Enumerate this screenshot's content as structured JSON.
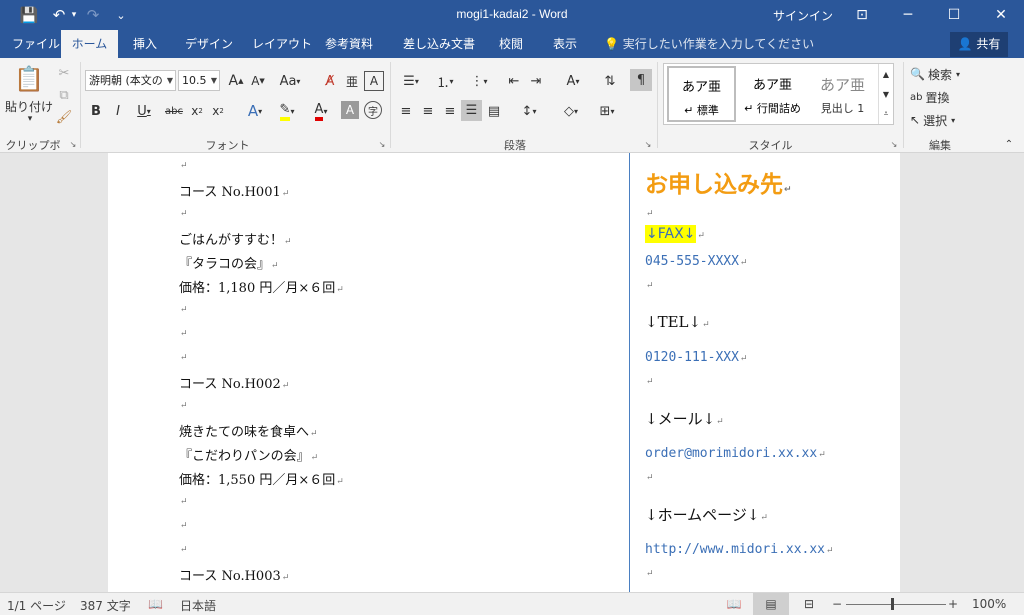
{
  "window": {
    "title": "mogi1-kadai2  -  Word",
    "signin": "サインイン",
    "buttons": {
      "ribbon_display": "⊡",
      "minimize": "─",
      "maximize": "☐",
      "close": "✕"
    }
  },
  "quick_access": {
    "save": "💾",
    "undo": "↶",
    "undo_arrow": "▾",
    "redo": "↷",
    "customize": "⌄"
  },
  "tabs": [
    "ファイル",
    "ホーム",
    "挿入",
    "デザイン",
    "レイアウト",
    "参考資料",
    "差し込み文書",
    "校閲",
    "表示"
  ],
  "tell_me": "実行したい作業を入力してください",
  "share": "共有",
  "ribbon": {
    "clipboard": {
      "paste": "貼り付け",
      "label": "クリップボード"
    },
    "font": {
      "name": "游明朝 (本文の",
      "size": "10.5",
      "label": "フォント",
      "aa": "Aa"
    },
    "paragraph": {
      "label": "段落"
    },
    "styles": {
      "label": "スタイル",
      "items": [
        {
          "preview": "あア亜",
          "name": "↵ 標準"
        },
        {
          "preview": "あア亜",
          "name": "↵ 行間詰め"
        },
        {
          "preview": "あア亜",
          "name": "見出し 1"
        }
      ]
    },
    "editing": {
      "label": "編集",
      "find": "検索",
      "replace": "置換",
      "select": "選択"
    }
  },
  "document": {
    "left_lines": [
      "",
      "コース No.H001",
      "",
      "ごはんがすすむ！",
      "『タラコの会』",
      "価格：1,180 円／月×６回",
      "",
      "",
      "",
      "コース No.H002",
      "",
      "焼きたての味を食卓へ",
      "『こだわりパンの会』",
      "価格：1,550 円／月×６回",
      "",
      "",
      "",
      "コース No.H003"
    ],
    "right": {
      "heading": "お申し込み先",
      "fax_label": "↓FAX↓",
      "fax": "045-555-XXXX",
      "tel_label": "↓TEL↓",
      "tel": "0120-111-XXX",
      "mail_label": "↓メール↓",
      "mail": "order@morimidori.xx.xx",
      "hp_label": "↓ホームページ↓",
      "hp": "http://www.midori.xx.xx"
    },
    "para_mark": "↵"
  },
  "status": {
    "page": "1/1 ページ",
    "words": "387 文字",
    "language": "日本語",
    "zoom": "100%"
  }
}
